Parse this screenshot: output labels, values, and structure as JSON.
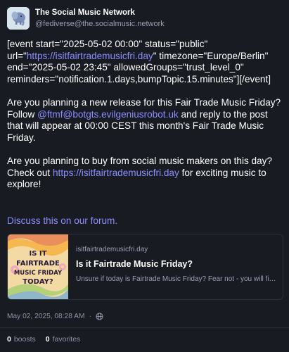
{
  "account": {
    "display_name": "The Social Music Network",
    "handle": "@fediverse@the.socialmusic.network",
    "avatar_icon": "elephant-logo-icon"
  },
  "post": {
    "event_pre": "[event start=\"2025-05-02 00:00\" status=\"public\" url=\"",
    "event_link": "https://isitfairtrademusicfri.day",
    "event_post": "\" timezone=\"Europe/Berlin\" end=\"2025-05-02 23:45\" allowedGroups=\"trust_level_0\" reminders=\"notification.1.days,bumpTopic.15.minutes\"][/event]",
    "p2_pre": "Are you planning a new release for this Fair Trade Music Friday? Follow ",
    "p2_link": "@ftmf@botgts.evilgeniusrobot.uk",
    "p2_post": " and reply to the post that will appear at 00:00 CEST this month's Fair Trade Music Friday.",
    "p3_pre": "Are you planning to buy from social music makers on this day? Check out ",
    "p3_link": "https://isitfairtrademusicfri.day",
    "p3_post": " for exciting music to explore!",
    "discuss": "Discuss this on our forum."
  },
  "card": {
    "thumb_text": [
      "IS IT",
      "FAIRTRADE",
      "MUSIC FRIDAY",
      "TODAY?"
    ],
    "host": "isitfairtrademusicfri.day",
    "title": "Is it Fairtrade Music Friday?",
    "description": "Unsure if today is Fairtrade Music Friday? Fear not - you will find..."
  },
  "meta": {
    "timestamp": "May 02, 2025, 08:28 AM",
    "separator": "·",
    "visibility_icon": "globe-icon"
  },
  "stats": {
    "boosts_count": "0",
    "boosts_label": "boosts",
    "favorites_count": "0",
    "favorites_label": "favorites"
  },
  "colors": {
    "background": "#191b22",
    "link": "#8c8dff",
    "muted": "#9aa0b2"
  }
}
